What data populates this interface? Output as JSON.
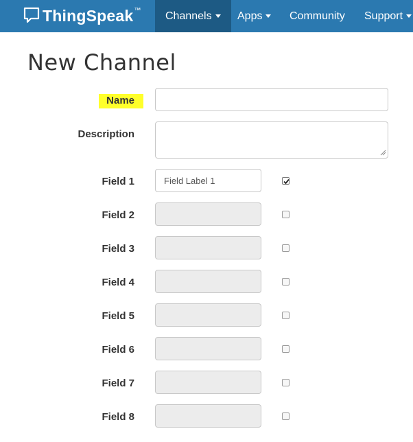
{
  "navbar": {
    "brand": {
      "name": "ThingSpeak",
      "trademark": "™",
      "icon": "speech-bubble-icon"
    },
    "items": [
      {
        "label": "Channels",
        "active": true,
        "has_dropdown": true
      },
      {
        "label": "Apps",
        "active": false,
        "has_dropdown": true
      },
      {
        "label": "Community",
        "active": false,
        "has_dropdown": false
      },
      {
        "label": "Support",
        "active": false,
        "has_dropdown": true
      }
    ],
    "colors": {
      "background": "#2b79b0",
      "active": "#1d5a84"
    }
  },
  "page": {
    "title": "New Channel"
  },
  "form": {
    "name": {
      "label": "Name",
      "value": "",
      "highlight_color": "#ffff2a"
    },
    "description": {
      "label": "Description",
      "value": ""
    },
    "fields": [
      {
        "label": "Field 1",
        "value": "Field Label 1",
        "checked": true,
        "enabled": true
      },
      {
        "label": "Field 2",
        "value": "",
        "checked": false,
        "enabled": false
      },
      {
        "label": "Field 3",
        "value": "",
        "checked": false,
        "enabled": false
      },
      {
        "label": "Field 4",
        "value": "",
        "checked": false,
        "enabled": false
      },
      {
        "label": "Field 5",
        "value": "",
        "checked": false,
        "enabled": false
      },
      {
        "label": "Field 6",
        "value": "",
        "checked": false,
        "enabled": false
      },
      {
        "label": "Field 7",
        "value": "",
        "checked": false,
        "enabled": false
      },
      {
        "label": "Field 8",
        "value": "",
        "checked": false,
        "enabled": false
      }
    ]
  }
}
